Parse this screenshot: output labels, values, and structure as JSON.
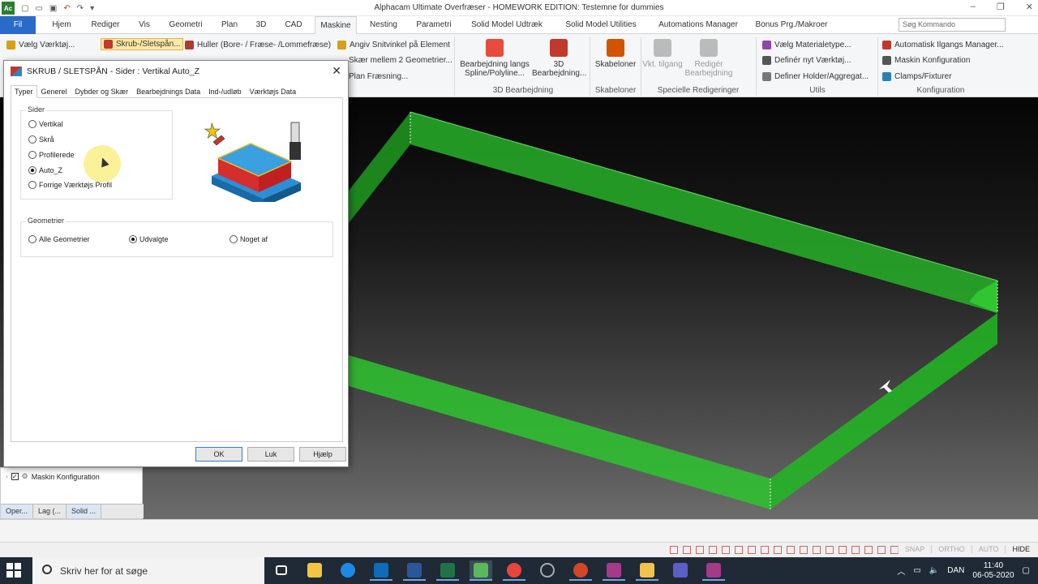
{
  "app": {
    "title": "Alphacam Ultimate Overfræser - HOMEWORK EDITION: Testemne for dummies",
    "window_controls": [
      "–",
      "❐",
      "✕"
    ]
  },
  "menu": {
    "file": "Fil",
    "tabs": [
      "Hjem",
      "Rediger",
      "Vis",
      "Geometri",
      "Plan",
      "3D",
      "CAD",
      "Maskine",
      "Nesting",
      "Parametri",
      "Solid Model Udtræk",
      "Solid Model Utilities",
      "Automations Manager",
      "Bonus Prg./Makroer"
    ],
    "active_tab": "Maskine",
    "search_placeholder": "Søg Kommando"
  },
  "ribbon": {
    "left_items": [
      "Vælg Værktøj...",
      "Skrub-/Sletspån...",
      "Huller (Bore- / Fræse- /Lommefræse)",
      "Angiv Snitvinkel på Element",
      "Skær mellem 2 Geometrier...",
      "Plan Fræsning..."
    ],
    "bearbejdning_btn": "Bearbejdning langs Spline/Polyline...",
    "bearbejdning3d_btn": "3D Bearbejdning...",
    "skabeloner_btn": "Skabeloner",
    "vkt_btn": "Vkt. tilgang",
    "rediger_btn": "Redigér Bearbejdning",
    "utils_items": [
      "Vælg Materialetype...",
      "Definér nyt Værktøj...",
      "Definer Holder/Aggregat..."
    ],
    "konfig_items": [
      "Automatisk Ilgangs Manager...",
      "Maskin Konfiguration",
      "Clamps/Fixturer"
    ],
    "groups": [
      "3D Bearbejdning",
      "Skabeloner",
      "Specielle Redigeringer",
      "Utils",
      "Konfiguration"
    ],
    "accent_color": "#2a6ac8"
  },
  "dialog": {
    "title": "SKRUB / SLETSPÅN - Sider : Vertikal Auto_Z",
    "tabs": [
      "Typer",
      "Generel",
      "Dybder og Skær",
      "Bearbejdnings Data",
      "Ind-/udløb",
      "Værktøjs Data"
    ],
    "active_tab": "Typer",
    "sider": {
      "legend": "Sider",
      "options": [
        "Vertikal",
        "Skrå",
        "Profilerede",
        "Auto_Z",
        "Forrige Værktøjs Profil"
      ],
      "selected": "Auto_Z"
    },
    "geometrier": {
      "legend": "Geometrier",
      "options": [
        "Alle Geometrier",
        "Udvalgte",
        "Noget af"
      ],
      "selected": "Udvalgte"
    },
    "buttons": {
      "ok": "OK",
      "close": "Luk",
      "help": "Hjælp"
    }
  },
  "left_panel": {
    "tree_item": "Maskin Konfiguration",
    "tabs": [
      "Oper...",
      "Lag (...",
      "Solid ..."
    ]
  },
  "statusbar": {
    "flags": [
      "SNAP",
      "ORTHO",
      "AUTO",
      "HIDE"
    ],
    "active_flag": "HIDE"
  },
  "taskbar": {
    "search_text": "Skriv her for at søge",
    "language": "DAN",
    "time": "11:40",
    "date": "06-05-2020"
  },
  "viewport": {
    "model_color": "#2ec42e"
  }
}
